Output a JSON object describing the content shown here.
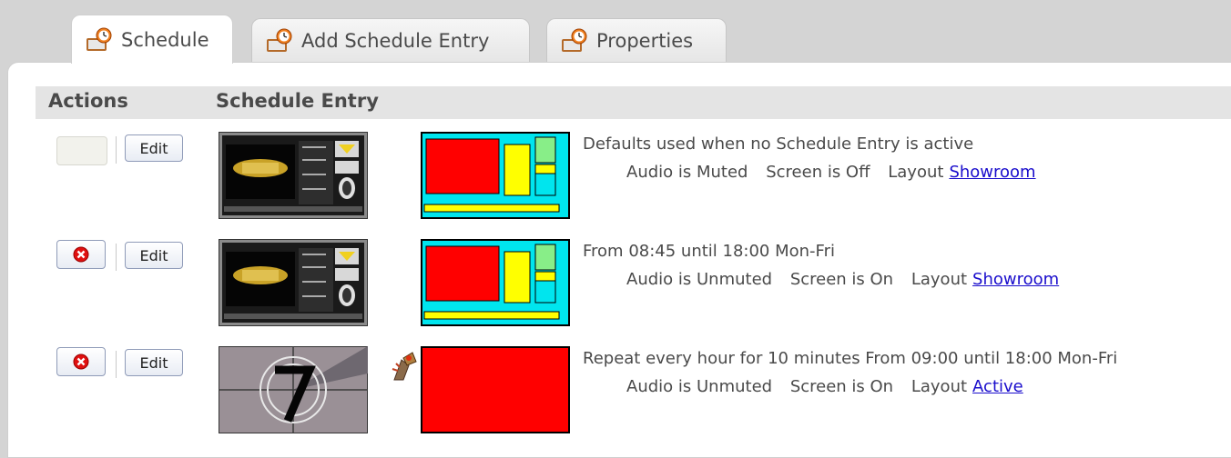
{
  "tabs": [
    {
      "label": "Schedule",
      "active": true
    },
    {
      "label": "Add Schedule Entry",
      "active": false
    },
    {
      "label": "Properties",
      "active": false
    }
  ],
  "table": {
    "headers": {
      "actions": "Actions",
      "entry": "Schedule Entry"
    },
    "edit_label": "Edit",
    "rows": [
      {
        "has_delete": false,
        "thumbnail": "showroom-video-thumbnail",
        "layout_preview": "showroom-layout",
        "description": "Defaults used when no Schedule Entry is active",
        "audio": "Audio is Muted",
        "screen": "Screen is Off",
        "layout_prefix": "Layout",
        "layout_name": "Showroom"
      },
      {
        "has_delete": true,
        "thumbnail": "showroom-video-thumbnail",
        "layout_preview": "showroom-layout",
        "description": "From 08:45 until 18:00 Mon-Fri",
        "audio": "Audio is Unmuted",
        "screen": "Screen is On",
        "layout_prefix": "Layout",
        "layout_name": "Showroom"
      },
      {
        "has_delete": true,
        "thumbnail": "countdown-leader-thumbnail",
        "layout_preview": "active-layout",
        "description": "Repeat every hour for 10 minutes From 09:00 until 18:00 Mon-Fri",
        "audio": "Audio is Unmuted",
        "screen": "Screen is On",
        "layout_prefix": "Layout",
        "layout_name": "Active"
      }
    ]
  },
  "colors": {
    "layout_bg": "#00e5ee",
    "zone_red": "#ff0000",
    "zone_yellow": "#ffff00",
    "zone_green": "#88ee88",
    "link": "#1a0dcc"
  },
  "icons": {
    "tab": "clock-schedule-icon",
    "delete": "delete-x-icon",
    "broken": "broken-image-icon"
  }
}
